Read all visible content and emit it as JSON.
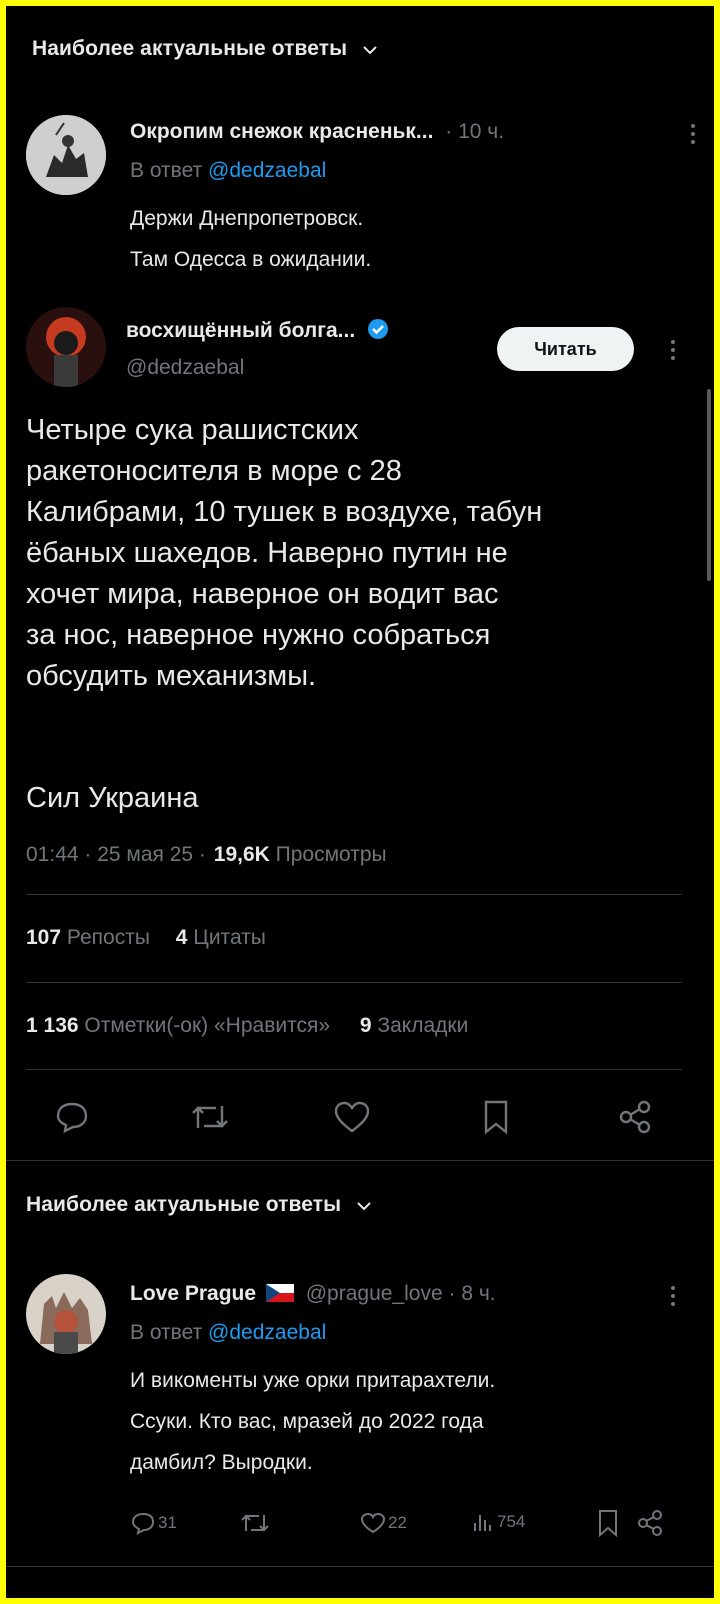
{
  "colors": {
    "frame_border": "#ffff00",
    "background": "#000000",
    "text": "#e7e9ea",
    "muted": "#71767b",
    "link": "#1d9bf0",
    "verified": "#1d9bf0",
    "divider": "#2f3336"
  },
  "top_section": {
    "title": "Наиболее актуальные ответы"
  },
  "reply1": {
    "name": "Окропим снежок красненьк...",
    "time": "· 10 ч.",
    "reply_prefix": "В ответ",
    "reply_handle": "@dedzaebal",
    "lines": [
      "Держи Днепропетровск.",
      "Там Одесса в ожидании."
    ]
  },
  "main_post": {
    "name": "восхищённый болга...",
    "handle": "@dedzaebal",
    "follow_label": "Читать",
    "text_lines": [
      "Четыре сука рашистских",
      "ракетоносителя в море с 28",
      "Калибрами, 10 тушек в воздухе, табун",
      "ёбаных шахедов. Наверно путин не",
      "хочет мира, наверное он водит вас",
      "за нос, наверное нужно собраться",
      "обсудить механизмы."
    ],
    "signature": "Сил Украина",
    "meta_time": "01:44 · 25 мая 25 ·",
    "views_count": "19,6K",
    "views_label": "Просмотры",
    "reposts_count": "107",
    "reposts_label": "Репосты",
    "quotes_count": "4",
    "quotes_label": "Цитаты",
    "likes_count": "1 136",
    "likes_label": "Отметки(-ок) «Нравится»",
    "bookmarks_count": "9",
    "bookmarks_label": "Закладки",
    "actions": [
      "reply-icon",
      "repost-icon",
      "like-icon",
      "bookmark-icon",
      "share-icon"
    ]
  },
  "bottom_section": {
    "title": "Наиболее актуальные ответы"
  },
  "reply2": {
    "name": "Love Prague",
    "flag": "czech-flag",
    "handle": "@prague_love",
    "time": "· 8 ч.",
    "reply_prefix": "В ответ",
    "reply_handle": "@dedzaebal",
    "lines": [
      "И викоменты уже орки притарахтели.",
      "Ссуки. Кто вас, мразей до 2022 года",
      "дамбил? Выродки."
    ],
    "reply_count": "31",
    "like_count": "22",
    "views_count": "754"
  }
}
